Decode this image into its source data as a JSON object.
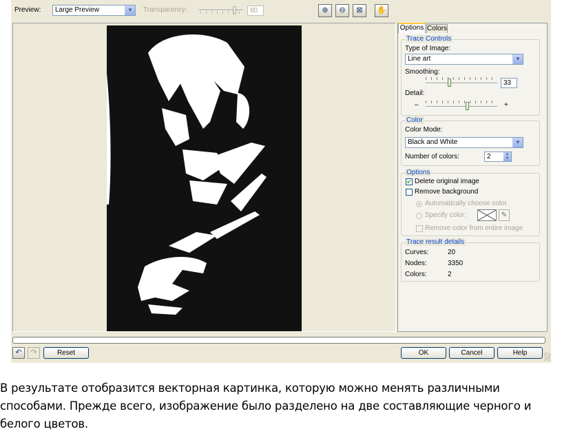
{
  "toolbar": {
    "preview_label": "Preview:",
    "preview_value": "Large Preview",
    "transparency_label": "Transparency:",
    "transparency_value": "80"
  },
  "tabs": [
    {
      "label": "Options",
      "active": true
    },
    {
      "label": "Colors",
      "active": false
    }
  ],
  "trace_controls": {
    "title": "Trace Controls",
    "type_label": "Type of Image:",
    "type_value": "Line art",
    "smoothing_label": "Smoothing:",
    "smoothing_value": "33",
    "smoothing_level": 0.33,
    "detail_label": "Detail:",
    "detail_minus": "–",
    "detail_plus": "+",
    "detail_level": 0.6
  },
  "color": {
    "title": "Color",
    "mode_label": "Color Mode:",
    "mode_value": "Black and White",
    "num_label": "Number of colors:",
    "num_value": "2"
  },
  "options": {
    "title": "Options",
    "delete_original": "Delete original image",
    "delete_checked": true,
    "remove_background": "Remove background",
    "remove_checked": false,
    "auto_color": "Automatically choose color",
    "specify_color": "Specify color:",
    "remove_entire": "Remove color from entire image"
  },
  "results": {
    "title": "Trace result details",
    "rows": [
      {
        "label": "Curves:",
        "value": "20"
      },
      {
        "label": "Nodes:",
        "value": "3350"
      },
      {
        "label": "Colors:",
        "value": "2"
      }
    ]
  },
  "buttons": {
    "reset": "Reset",
    "ok": "OK",
    "cancel": "Cancel",
    "help": "Help"
  },
  "caption": "В результате отобразится векторная картинка, которую можно менять различными способами. Прежде всего, изображение было разделено на две составляющие черного и белого цветов.",
  "colors": {
    "dialog_bg": "#ece9d8",
    "accent_blue": "#0046d5",
    "disabled_text": "#a8a596"
  }
}
